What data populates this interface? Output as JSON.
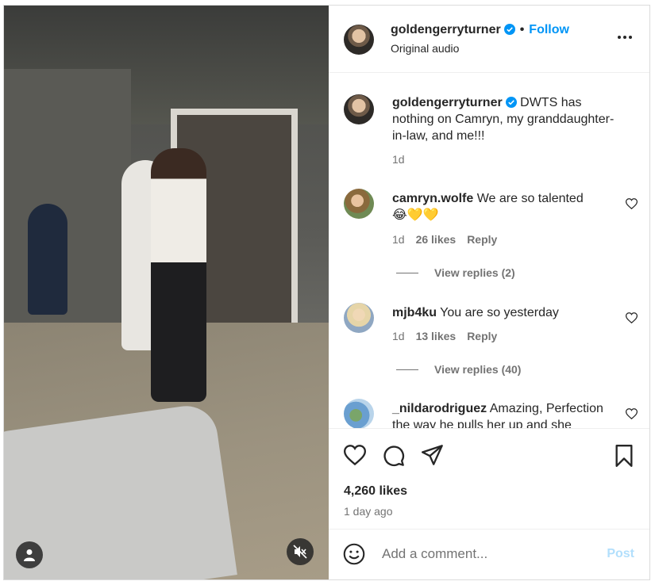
{
  "post": {
    "username": "goldengerryturner",
    "follow_label": "Follow",
    "audio": "Original audio",
    "caption": "DWTS has nothing on Camryn, my granddaughter-in-law, and me!!!",
    "caption_time": "1d"
  },
  "comments": [
    {
      "username": "camryn.wolfe",
      "text": "We are so talented",
      "emoji": "😂💛💛",
      "time": "1d",
      "likes": "26 likes",
      "reply": "Reply",
      "view_replies": "View replies (2)"
    },
    {
      "username": "mjb4ku",
      "text": "You are so yesterday",
      "time": "1d",
      "likes": "13 likes",
      "reply": "Reply",
      "view_replies": "View replies (40)"
    },
    {
      "username": "_nildarodriguez",
      "text": "Amazing, Perfection the way he pulls her up and she"
    }
  ],
  "actions": {
    "likes": "4,260 likes",
    "time_ago": "1 day ago"
  },
  "add_comment": {
    "placeholder": "Add a comment...",
    "post_label": "Post"
  },
  "icons": {
    "verified": "verified-badge-icon",
    "more": "more-options-icon",
    "like": "heart-icon",
    "comment": "comment-icon",
    "share": "share-icon",
    "save": "bookmark-icon",
    "emoji": "emoji-icon",
    "mute": "muted-speaker-icon",
    "tagged": "user-icon"
  },
  "colors": {
    "accent": "#0095f6",
    "post_disabled": "#b2dffc",
    "muted_text": "#737373"
  }
}
